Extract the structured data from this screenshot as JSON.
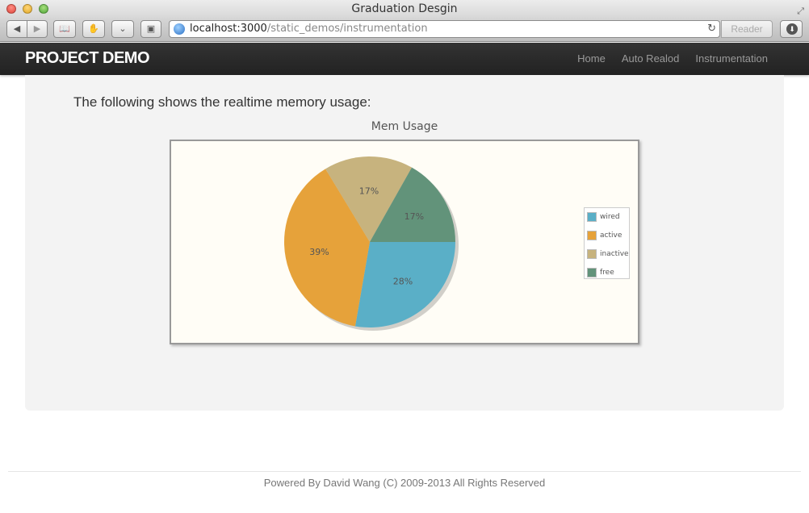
{
  "window": {
    "title": "Graduation Desgin"
  },
  "browser": {
    "url_host": "localhost:3000",
    "url_path": "/static_demos/instrumentation",
    "reader_label": "Reader"
  },
  "navbar": {
    "brand": "PROJECT DEMO",
    "links": [
      "Home",
      "Auto Realod",
      "Instrumentation"
    ]
  },
  "main": {
    "intro": "The following shows the realtime memory usage:"
  },
  "chart_data": {
    "type": "pie",
    "title": "Mem Usage",
    "labels": [
      "wired",
      "active",
      "inactive",
      "free"
    ],
    "values": [
      28,
      39,
      17,
      17
    ],
    "value_labels": [
      "28%",
      "39%",
      "17%",
      "17%"
    ],
    "colors": [
      "#5aafc7",
      "#e6a23a",
      "#c7b37e",
      "#62937a"
    ],
    "legend_position": "right"
  },
  "footer": {
    "text": "Powered By David Wang (C) 2009-2013 All Rights Reserved"
  }
}
